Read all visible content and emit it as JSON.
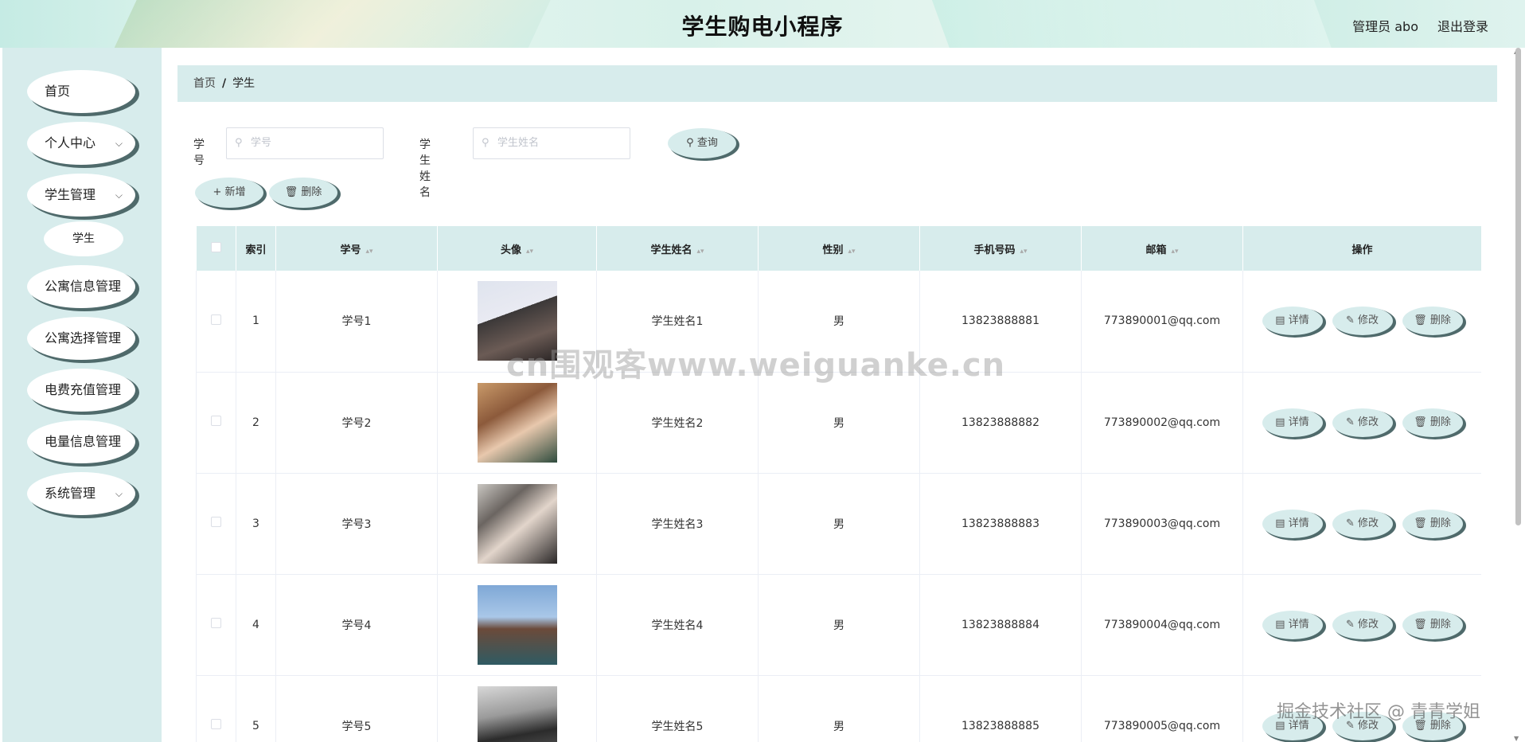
{
  "header": {
    "title": "学生购电小程序",
    "admin_label": "管理员 abo",
    "logout_label": "退出登录"
  },
  "sidebar": {
    "items": [
      {
        "label": "首页",
        "has_chevron": false
      },
      {
        "label": "个人中心",
        "has_chevron": true
      },
      {
        "label": "学生管理",
        "has_chevron": true
      },
      {
        "label": "公寓信息管理",
        "has_chevron": false
      },
      {
        "label": "公寓选择管理",
        "has_chevron": false
      },
      {
        "label": "电费充值管理",
        "has_chevron": false
      },
      {
        "label": "电量信息管理",
        "has_chevron": false
      },
      {
        "label": "系统管理",
        "has_chevron": true
      }
    ],
    "sub_item": "学生",
    "chevron": "⌵"
  },
  "breadcrumb": {
    "home": "首页",
    "sep": "/",
    "current": "学生"
  },
  "search": {
    "student_no_label": "学号",
    "student_no_placeholder": "学号",
    "student_name_label": "学生姓名",
    "student_name_placeholder": "学生姓名",
    "query_label": "查询",
    "search_icon": "search-icon"
  },
  "actions": {
    "add_label": "新增",
    "delete_label": "删除"
  },
  "table": {
    "headers": [
      "索引",
      "学号",
      "头像",
      "学生姓名",
      "性别",
      "手机号码",
      "邮箱",
      "操作"
    ],
    "sort_glyph": "▴▾",
    "rows": [
      {
        "index": "1",
        "no": "学号1",
        "name": "学生姓名1",
        "gender": "男",
        "phone": "13823888881",
        "email": "773890001@qq.com"
      },
      {
        "index": "2",
        "no": "学号2",
        "name": "学生姓名2",
        "gender": "男",
        "phone": "13823888882",
        "email": "773890002@qq.com"
      },
      {
        "index": "3",
        "no": "学号3",
        "name": "学生姓名3",
        "gender": "男",
        "phone": "13823888883",
        "email": "773890003@qq.com"
      },
      {
        "index": "4",
        "no": "学号4",
        "name": "学生姓名4",
        "gender": "男",
        "phone": "13823888884",
        "email": "773890004@qq.com"
      },
      {
        "index": "5",
        "no": "学号5",
        "name": "学生姓名5",
        "gender": "男",
        "phone": "13823888885",
        "email": "773890005@qq.com"
      }
    ],
    "row_actions": {
      "detail": "详情",
      "edit": "修改",
      "delete": "删除"
    }
  },
  "watermarks": {
    "center": "cn围观客www.weiguanke.cn",
    "corner": "掘金技术社区 @ 青青学姐"
  },
  "colors": {
    "accent_bg": "#d7ecec",
    "button_shadow": "#4f6a6b"
  }
}
